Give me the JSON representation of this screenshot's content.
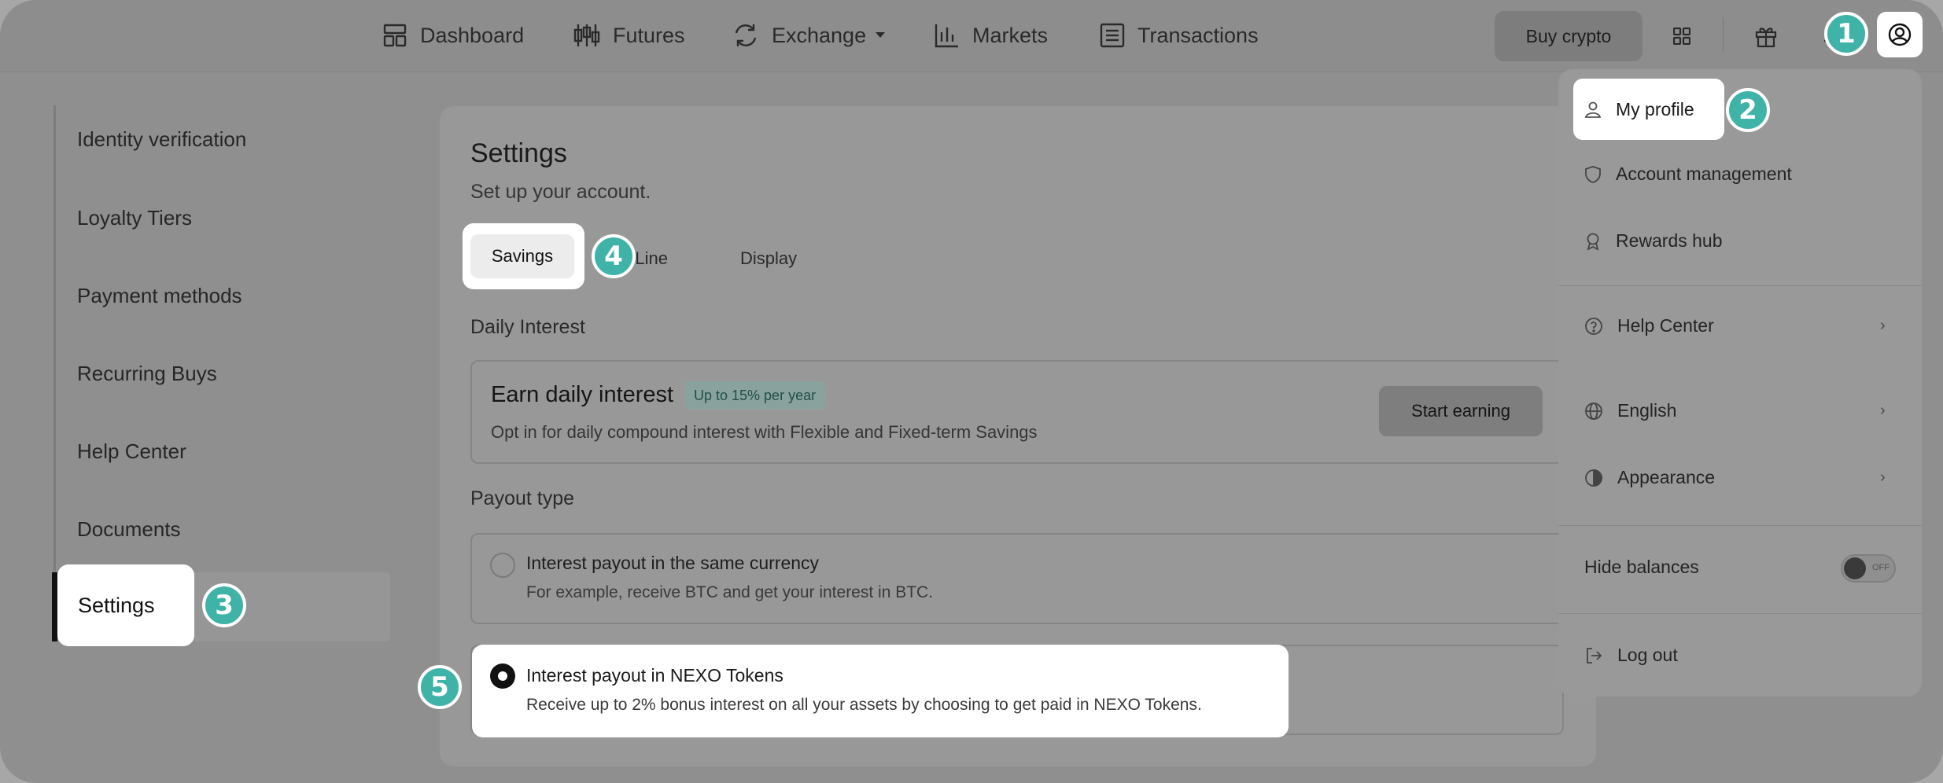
{
  "nav": {
    "items": [
      {
        "label": "Dashboard",
        "icon": "dashboard-icon"
      },
      {
        "label": "Futures",
        "icon": "candlestick-icon"
      },
      {
        "label": "Exchange",
        "icon": "exchange-icon"
      },
      {
        "label": "Markets",
        "icon": "bar-chart-icon"
      },
      {
        "label": "Transactions",
        "icon": "list-icon"
      }
    ],
    "buy_label": "Buy crypto"
  },
  "sidebar": {
    "items": [
      {
        "label": "Identity verification"
      },
      {
        "label": "Loyalty Tiers"
      },
      {
        "label": "Payment methods"
      },
      {
        "label": "Recurring Buys"
      },
      {
        "label": "Help Center"
      },
      {
        "label": "Documents"
      },
      {
        "label": "Settings"
      }
    ]
  },
  "main": {
    "title": "Settings",
    "subtitle": "Set up your account.",
    "tabs": [
      {
        "label": "Savings"
      },
      {
        "label": "Credit Line",
        "visible_text": "dit Line"
      },
      {
        "label": "Display"
      }
    ],
    "daily_interest": {
      "label": "Daily Interest",
      "title": "Earn daily interest",
      "badge": "Up to 15% per year",
      "description": "Opt in for daily compound interest with Flexible and Fixed-term Savings",
      "button": "Start earning"
    },
    "payout": {
      "label": "Payout type",
      "options": [
        {
          "title": "Interest payout in the same currency",
          "description": "For example, receive BTC and get your interest in BTC.",
          "selected": false
        },
        {
          "title": "Interest payout in NEXO Tokens",
          "description": "Receive up to 2% bonus interest on all your assets by choosing to get paid in NEXO Tokens.",
          "selected": true
        }
      ]
    }
  },
  "dropdown": {
    "items": [
      {
        "label": "My profile"
      },
      {
        "label": "Account management"
      },
      {
        "label": "Rewards hub"
      },
      {
        "label": "Help Center"
      },
      {
        "label": "English"
      },
      {
        "label": "Appearance"
      },
      {
        "label": "Hide balances"
      },
      {
        "label": "Log out"
      }
    ],
    "toggle_state": "OFF"
  },
  "markers": [
    "1",
    "2",
    "3",
    "4",
    "5"
  ],
  "colors": {
    "marker": "#3fb3a8",
    "badge_text": "#1f4f47"
  }
}
